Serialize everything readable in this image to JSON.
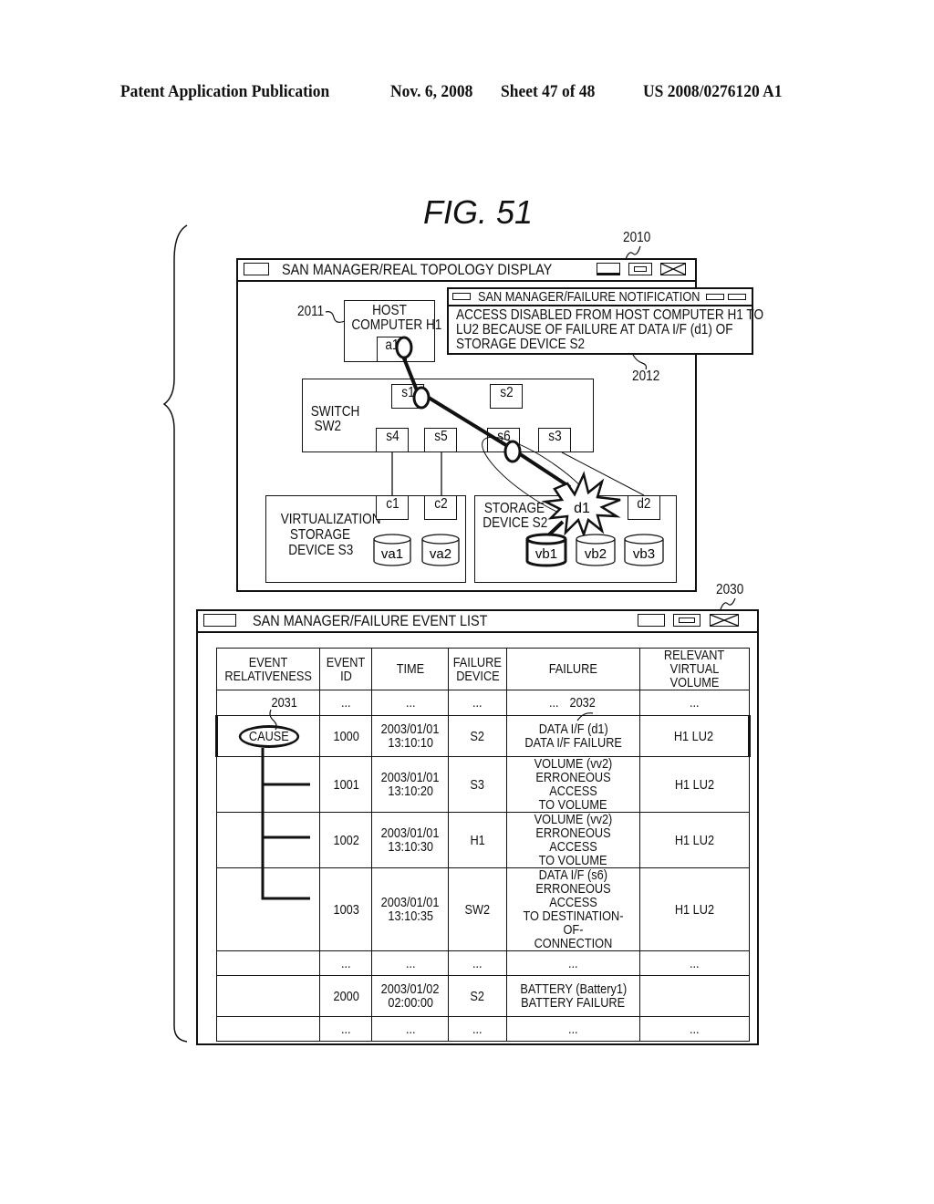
{
  "header": {
    "publication": "Patent Application Publication",
    "date": "Nov. 6, 2008",
    "sheet": "Sheet 47 of 48",
    "number": "US 2008/0276120 A1"
  },
  "figure": {
    "label": "FIG. 51"
  },
  "refs": {
    "topology_window": "2010",
    "host": "2011",
    "notification": "2012",
    "event_list_window": "2030",
    "cause_marker": "2031",
    "failure_row": "2032"
  },
  "topology": {
    "title": "SAN MANAGER/REAL TOPOLOGY DISPLAY",
    "window_controls": [
      "minimize-icon",
      "maximize-icon",
      "close-icon"
    ],
    "host": {
      "line1": "HOST",
      "line2": "COMPUTER H1",
      "port": "a1"
    },
    "switch": {
      "line1": "SWITCH",
      "line2": "SW2",
      "ports": [
        "s1",
        "s2",
        "s4",
        "s5",
        "s6",
        "s3"
      ]
    },
    "virt_storage": {
      "line1": "VIRTUALIZATION",
      "line2": "STORAGE",
      "line3": "DEVICE S3",
      "ports": [
        "c1",
        "c2"
      ],
      "volumes": [
        "va1",
        "va2"
      ]
    },
    "storage": {
      "line1": "STORAGE",
      "line2": "DEVICE S2",
      "ports": [
        "d1",
        "d2"
      ],
      "volumes": [
        "vb1",
        "vb2",
        "vb3"
      ]
    },
    "failed_port": "d1",
    "failure_path": [
      "a1",
      "s1",
      "s6",
      "d1",
      "vb1"
    ]
  },
  "notification": {
    "title": "SAN MANAGER/FAILURE NOTIFICATION",
    "lines": [
      "ACCESS DISABLED FROM HOST COMPUTER H1 TO",
      "LU2 BECAUSE OF FAILURE AT DATA I/F (d1) OF",
      "STORAGE DEVICE S2"
    ]
  },
  "event_list": {
    "title": "SAN MANAGER/FAILURE EVENT LIST",
    "columns": [
      [
        "EVENT",
        "RELATIVENESS"
      ],
      [
        "EVENT",
        "ID"
      ],
      [
        "TIME"
      ],
      [
        "FAILURE",
        "DEVICE"
      ],
      [
        "FAILURE"
      ],
      [
        "RELEVANT",
        "VIRTUAL VOLUME"
      ]
    ],
    "ellipsis": "...",
    "cause_label": "CAUSE",
    "rows": [
      {
        "rel": "",
        "id": "...",
        "time": [
          "..."
        ],
        "device": "...",
        "failure": [
          "..."
        ],
        "volume": "..."
      },
      {
        "rel": "CAUSE",
        "id": "1000",
        "time": [
          "2003/01/01",
          "13:10:10"
        ],
        "device": "S2",
        "failure": [
          "DATA I/F (d1)",
          "DATA I/F FAILURE"
        ],
        "volume": "H1 LU2"
      },
      {
        "rel": "child",
        "id": "1001",
        "time": [
          "2003/01/01",
          "13:10:20"
        ],
        "device": "S3",
        "failure": [
          "VOLUME (vv2)",
          "ERRONEOUS ACCESS",
          "TO VOLUME"
        ],
        "volume": "H1 LU2"
      },
      {
        "rel": "child",
        "id": "1002",
        "time": [
          "2003/01/01",
          "13:10:30"
        ],
        "device": "H1",
        "failure": [
          "VOLUME (vv2)",
          "ERRONEOUS ACCESS",
          "TO VOLUME"
        ],
        "volume": "H1 LU2"
      },
      {
        "rel": "child-last",
        "id": "1003",
        "time": [
          "2003/01/01",
          "13:10:35"
        ],
        "device": "SW2",
        "failure": [
          "DATA I/F (s6)",
          "ERRONEOUS ACCESS",
          "TO DESTINATION-OF-",
          "CONNECTION"
        ],
        "volume": "H1 LU2"
      },
      {
        "rel": "",
        "id": "...",
        "time": [
          "..."
        ],
        "device": "...",
        "failure": [
          "..."
        ],
        "volume": "..."
      },
      {
        "rel": "",
        "id": "2000",
        "time": [
          "2003/01/02",
          "02:00:00"
        ],
        "device": "S2",
        "failure": [
          "BATTERY (Battery1)",
          "BATTERY FAILURE"
        ],
        "volume": ""
      },
      {
        "rel": "",
        "id": "...",
        "time": [
          "..."
        ],
        "device": "...",
        "failure": [
          "..."
        ],
        "volume": "..."
      }
    ]
  }
}
